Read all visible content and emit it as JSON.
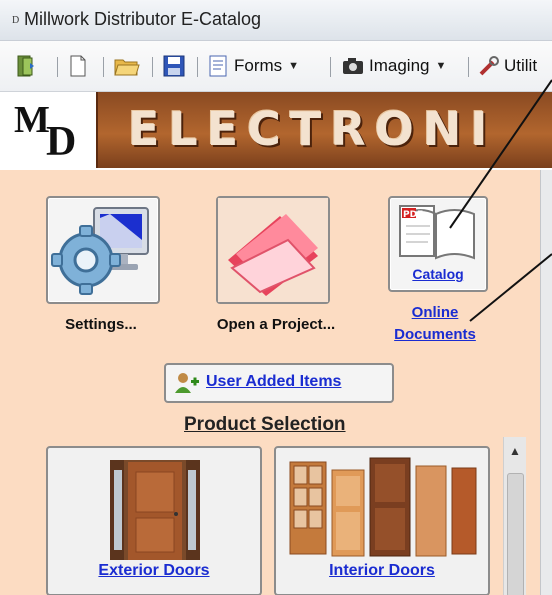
{
  "window": {
    "title": "Millwork Distributor E-Catalog",
    "app_icon_letter": "D"
  },
  "toolbar": {
    "forms_label": "Forms",
    "imaging_label": "Imaging",
    "utilities_label": "Utilit"
  },
  "banner": {
    "logo_m": "M",
    "logo_d": "D",
    "text": "ELECTRONI"
  },
  "actions": [
    {
      "label": "Settings...",
      "icon": "settings-monitor-gear-icon"
    },
    {
      "label": "Open a Project...",
      "icon": "open-folder-icon"
    },
    {
      "label_line1": "Online",
      "label_line2": "Documents",
      "inner_label": "Catalog",
      "icon": "pdf-book-icon"
    }
  ],
  "user_items_button": {
    "label": "User Added Items",
    "icon": "add-user-icon"
  },
  "product_section": {
    "title": "Product Selection",
    "products": [
      {
        "label": "Exterior Doors",
        "icon": "exterior-door-icon"
      },
      {
        "label": "Interior Doors",
        "icon": "interior-doors-icon"
      }
    ]
  },
  "colors": {
    "background": "#fcdcc2",
    "link": "#1a2cd1",
    "banner": "#b2662e"
  }
}
